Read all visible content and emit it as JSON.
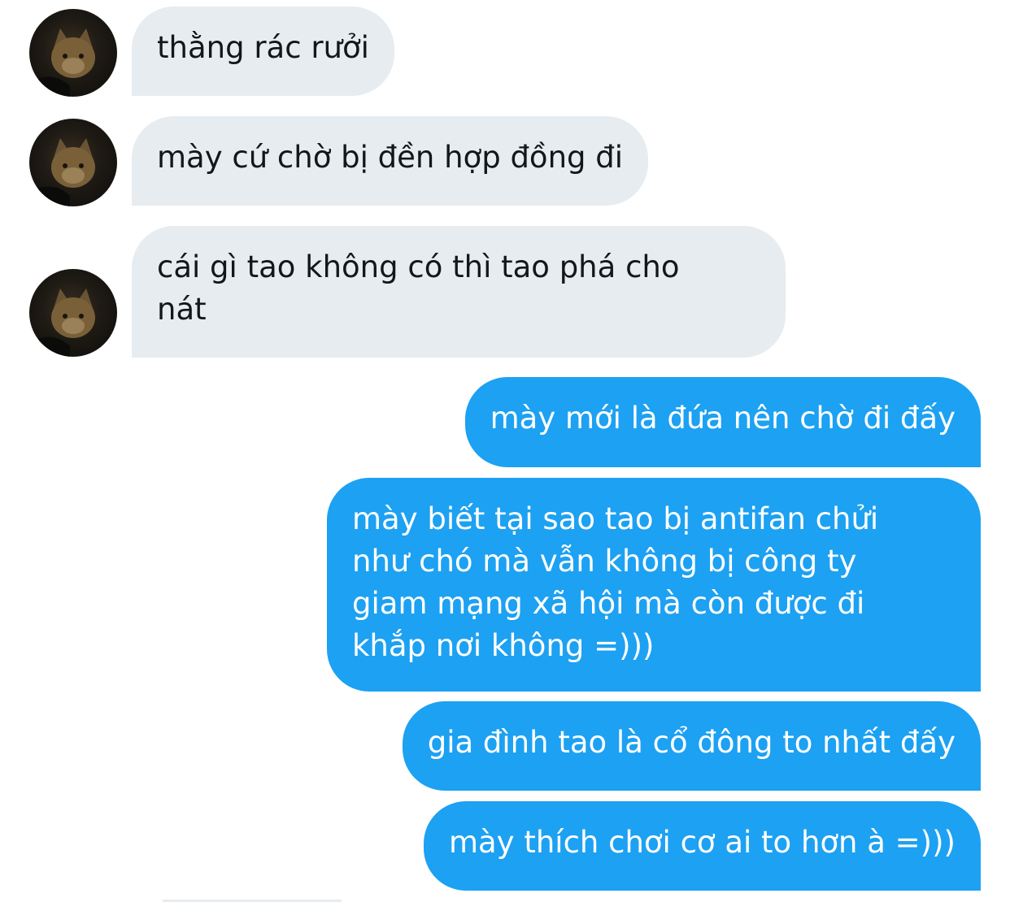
{
  "conversation": {
    "incoming_avatar": {
      "icon": "cat-avatar-icon",
      "description_color": "#2b2418"
    },
    "incoming_bubble_color": "#e6ecf0",
    "outgoing_bubble_color": "#1da1f2",
    "messages": [
      {
        "sender": "other",
        "text": "thằng rác rưởi"
      },
      {
        "sender": "other",
        "text": "mày cứ chờ bị đền hợp đồng đi"
      },
      {
        "sender": "other",
        "lines": [
          "cái gì tao không có thì tao phá cho",
          "nát"
        ]
      },
      {
        "sender": "me",
        "text": "mày mới là đứa nên chờ đi đấy"
      },
      {
        "sender": "me",
        "lines": [
          "mày biết tại sao tao bị antifan chửi",
          "như chó mà vẫn không bị công ty",
          "giam mạng xã hội mà còn được đi",
          "khắp nơi không =)))"
        ]
      },
      {
        "sender": "me",
        "text": "gia đình tao là cổ đông to nhất đấy"
      },
      {
        "sender": "me",
        "text": "mày thích chơi cơ ai to hơn à =)))"
      }
    ]
  }
}
